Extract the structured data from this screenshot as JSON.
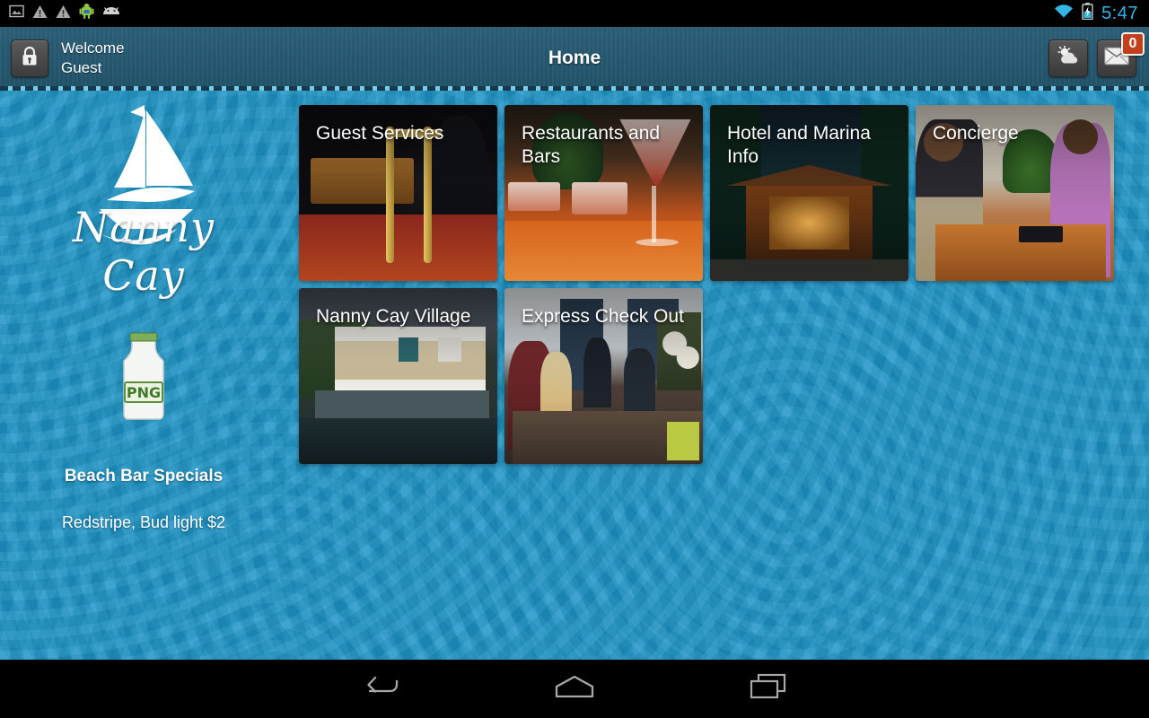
{
  "statusbar": {
    "clock": "5:47",
    "left_icons": [
      "screenshot-image-icon",
      "warning-triangle-icon",
      "warning-triangle-icon",
      "android-robot-icon",
      "android-head-icon"
    ],
    "right_icons": [
      "wifi-icon",
      "battery-charging-icon"
    ]
  },
  "header": {
    "lock_icon": "lock-icon",
    "welcome_line1": "Welcome",
    "welcome_line2": "Guest",
    "title": "Home",
    "weather_icon": "sun-cloud-icon",
    "mail_icon": "envelope-icon",
    "mail_badge": "0",
    "badge_color": "#c2411c",
    "bar_color": "#275a72"
  },
  "sidebar": {
    "brand_name": "Nanny Cay",
    "logo_icon": "sailboat-logo-icon",
    "placeholder_icon": "png-placeholder-image",
    "promo_title": "Beach Bar Specials",
    "promo_body": "Redstripe, Bud light $2"
  },
  "main": {
    "background_color": "#1e96c8",
    "tiles": [
      {
        "label": "Guest Services",
        "image": "bellhop-luggage-cart-photo",
        "scene": "img-guest"
      },
      {
        "label": "Restaurants and Bars",
        "image": "cocktail-on-bar-photo",
        "scene": "img-rest"
      },
      {
        "label": "Hotel and Marina Info",
        "image": "hotel-entrance-night-photo",
        "scene": "img-hotel"
      },
      {
        "label": "Concierge",
        "image": "concierge-desk-photo",
        "scene": "img-conc"
      },
      {
        "label": "Nanny Cay Village",
        "image": "waterfront-village-photo",
        "scene": "img-village"
      },
      {
        "label": "Express Check Out",
        "image": "reception-checkout-photo",
        "scene": "img-express"
      }
    ]
  },
  "navbar": {
    "back_icon": "back-arrow-icon",
    "home_icon": "home-icon",
    "recents_icon": "recent-apps-icon"
  }
}
